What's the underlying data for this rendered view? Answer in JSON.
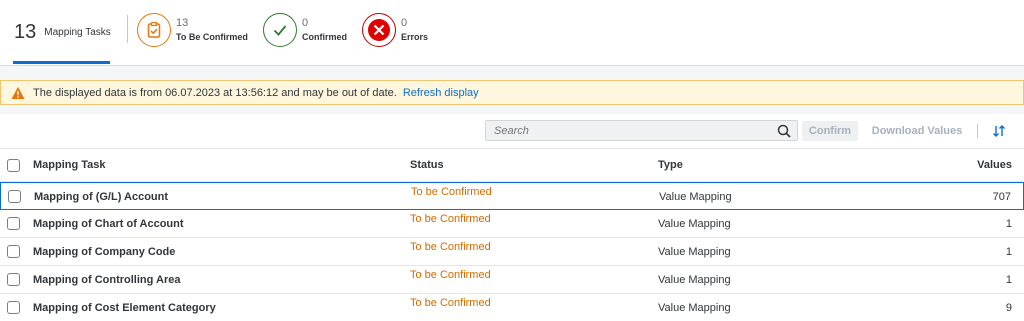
{
  "header": {
    "total_count": "13",
    "total_label": "Mapping Tasks",
    "tabs": [
      {
        "count": "13",
        "label": "To Be Confirmed",
        "color": "#e9730c",
        "icon": "clipboard-check-icon"
      },
      {
        "count": "0",
        "label": "Confirmed",
        "color": "#2b7c2b",
        "icon": "checkmark-icon"
      },
      {
        "count": "0",
        "label": "Errors",
        "color": "#bb0000",
        "icon": "error-x-icon"
      }
    ]
  },
  "message": {
    "text": "The displayed data is from 06.07.2023 at 13:56:12 and may be out of date.",
    "link": "Refresh display"
  },
  "toolbar": {
    "search_placeholder": "Search",
    "confirm_label": "Confirm",
    "download_label": "Download Values"
  },
  "table": {
    "columns": [
      "Mapping Task",
      "Status",
      "Type",
      "Values"
    ],
    "rows": [
      {
        "task": "Mapping of (G/L) Account",
        "status": "To be Confirmed",
        "type": "Value Mapping",
        "values": "707"
      },
      {
        "task": "Mapping of Chart of Account",
        "status": "To be Confirmed",
        "type": "Value Mapping",
        "values": "1"
      },
      {
        "task": "Mapping of Company Code",
        "status": "To be Confirmed",
        "type": "Value Mapping",
        "values": "1"
      },
      {
        "task": "Mapping of Controlling Area",
        "status": "To be Confirmed",
        "type": "Value Mapping",
        "values": "1"
      },
      {
        "task": "Mapping of Cost Element Category",
        "status": "To be Confirmed",
        "type": "Value Mapping",
        "values": "9"
      }
    ]
  }
}
